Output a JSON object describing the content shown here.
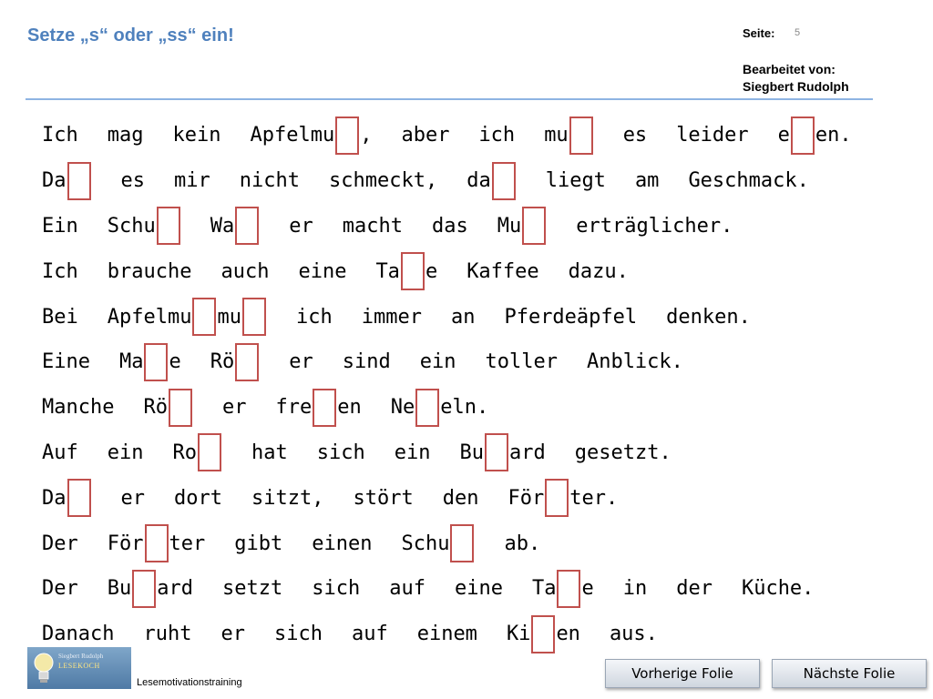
{
  "header": {
    "title": "Setze „s“ oder „ss“ ein!",
    "page_label": "Seite:",
    "page_number": "5",
    "editor_label": "Bearbeitet von:",
    "editor_name": "Siegbert Rudolph"
  },
  "sentences": [
    [
      "Ich",
      "mag",
      "kein",
      "Apfelmu",
      "_",
      ",",
      "aber",
      "ich",
      "mu",
      "_",
      "es",
      "leider",
      "e",
      "_",
      "en."
    ],
    [
      "Da",
      "_",
      "es",
      "mir",
      "nicht",
      "schmeckt,",
      "da",
      "_",
      "liegt",
      "am",
      "Geschmack."
    ],
    [
      "Ein",
      "Schu",
      "_",
      "Wa",
      "_",
      "er",
      "macht",
      "das",
      "Mu",
      "_",
      "erträglicher."
    ],
    [
      "Ich",
      "brauche",
      "auch",
      "eine",
      "Ta",
      "_",
      "e",
      "Kaffee",
      "dazu."
    ],
    [
      "Bei",
      "Apfelmu",
      "_",
      "mu",
      "_",
      "ich",
      "immer",
      "an",
      "Pferdeäpfel",
      "denken."
    ],
    [
      "Eine",
      "Ma",
      "_",
      "e",
      "Rö",
      "_",
      "er",
      "sind",
      "ein",
      "toller",
      "Anblick."
    ],
    [
      "Manche",
      "Rö",
      "_",
      "er",
      "fre",
      "_",
      "en",
      "Ne",
      "_",
      "eln."
    ],
    [
      "Auf",
      "ein",
      "Ro",
      "_",
      "hat",
      "sich",
      "ein",
      "Bu",
      "_",
      "ard",
      "gesetzt."
    ],
    [
      "Da",
      "_",
      "er",
      "dort",
      "sitzt,",
      "stört",
      "den",
      "För",
      "_",
      "ter."
    ],
    [
      "Der",
      "För",
      "_",
      "ter",
      "gibt",
      "einen",
      "Schu",
      "_",
      "ab."
    ],
    [
      "Der",
      "Bu",
      "_",
      "ard",
      "setzt",
      "sich",
      "auf",
      "eine",
      "Ta",
      "_",
      "e",
      "in",
      "der",
      "Küche."
    ],
    [
      "Danach",
      "ruht",
      "er",
      "sich",
      "auf",
      "einem",
      "Ki",
      "_",
      "en",
      "aus."
    ]
  ],
  "footer": {
    "logo_line1": "Siegbert Rudolph",
    "logo_line2": "LESEKOCH",
    "label": "Lesemotivationstraining"
  },
  "nav": {
    "prev_label": "Vorherige Folie",
    "next_label": "Nächste Folie"
  },
  "colors": {
    "title": "#4f81bd",
    "blank_border": "#c0504d",
    "divider": "#8eb4e3"
  }
}
